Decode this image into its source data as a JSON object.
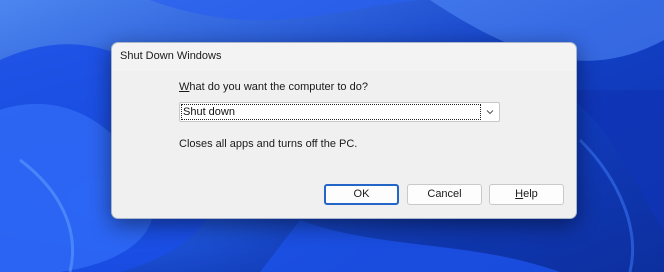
{
  "dialog": {
    "title": "Shut Down Windows",
    "prompt_prefix": "",
    "prompt_accel": "W",
    "prompt_rest": "hat do you want the computer to do?",
    "selected_option": "Shut down",
    "description": "Closes all apps and turns off the PC.",
    "ok_label": "OK",
    "cancel_label": "Cancel",
    "help_accel": "H",
    "help_rest": "elp"
  },
  "colors": {
    "accent": "#2366c8",
    "dialog_bg": "#f0f0f0",
    "wallpaper_base": "#1d4fe0"
  },
  "icons": {
    "dropdown": "chevron-down-icon"
  }
}
